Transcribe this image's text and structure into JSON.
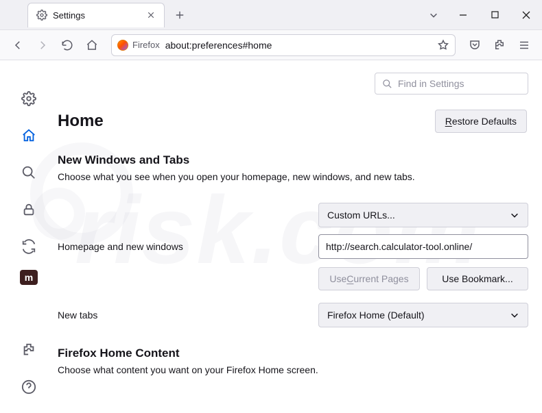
{
  "window": {
    "tab_title": "Settings",
    "url_identity": "Firefox",
    "url": "about:preferences#home"
  },
  "search": {
    "placeholder": "Find in Settings"
  },
  "page": {
    "title": "Home",
    "restore_btn": "Restore Defaults",
    "restore_key": "R",
    "section1_heading": "New Windows and Tabs",
    "section1_desc": "Choose what you see when you open your homepage, new windows, and new tabs.",
    "homepage_label": "Homepage and new windows",
    "homepage_select": "Custom URLs...",
    "homepage_url": "http://search.calculator-tool.online/",
    "use_current_btn": "Use Current Pages",
    "use_current_key": "C",
    "use_bookmark_btn": "Use Bookmark...",
    "newtabs_label": "New tabs",
    "newtabs_select": "Firefox Home (Default)",
    "section2_heading": "Firefox Home Content",
    "section2_desc": "Choose what content you want on your Firefox Home screen."
  },
  "sidebar": {
    "items": [
      {
        "name": "general",
        "icon": "gear"
      },
      {
        "name": "home",
        "icon": "home",
        "active": true
      },
      {
        "name": "search",
        "icon": "search"
      },
      {
        "name": "privacy",
        "icon": "lock"
      },
      {
        "name": "sync",
        "icon": "sync"
      },
      {
        "name": "m-ext",
        "icon": "m"
      }
    ]
  },
  "watermark": "risk.com"
}
